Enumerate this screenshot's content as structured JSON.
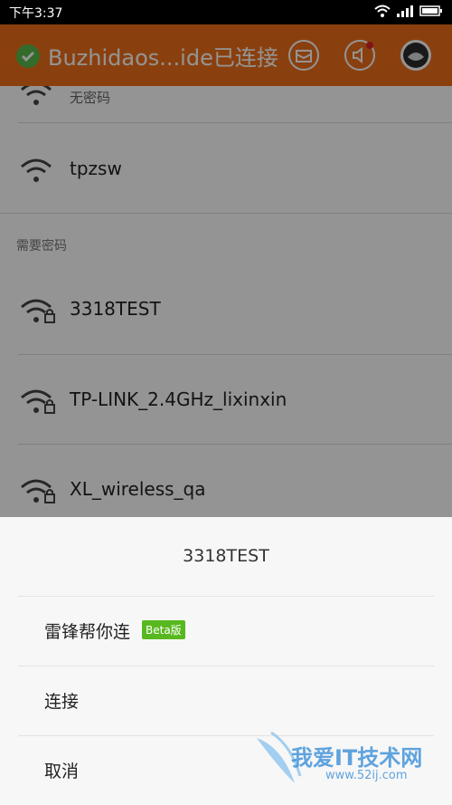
{
  "status_bar": {
    "time": "下午3:37"
  },
  "header": {
    "title": "Buzhidaos...ide已连接"
  },
  "networks": {
    "partial_subtitle": "无密码",
    "open": [
      {
        "ssid": "tpzsw"
      }
    ],
    "secure_section_label": "需要密码",
    "secure": [
      {
        "ssid": "3318TEST"
      },
      {
        "ssid": "TP-LINK_2.4GHz_lixinxin"
      },
      {
        "ssid": "XL_wireless_qa"
      }
    ]
  },
  "sheet": {
    "title": "3318TEST",
    "options": [
      {
        "label": "雷锋帮你连",
        "badge": "Beta版"
      },
      {
        "label": "连接"
      },
      {
        "label": "取消"
      }
    ]
  },
  "watermark": {
    "text": "我爱IT技术网",
    "url": "www.52ij.com"
  },
  "colors": {
    "accent": "#ee6f19",
    "connected": "#58b84a",
    "beta": "#58b81f"
  }
}
